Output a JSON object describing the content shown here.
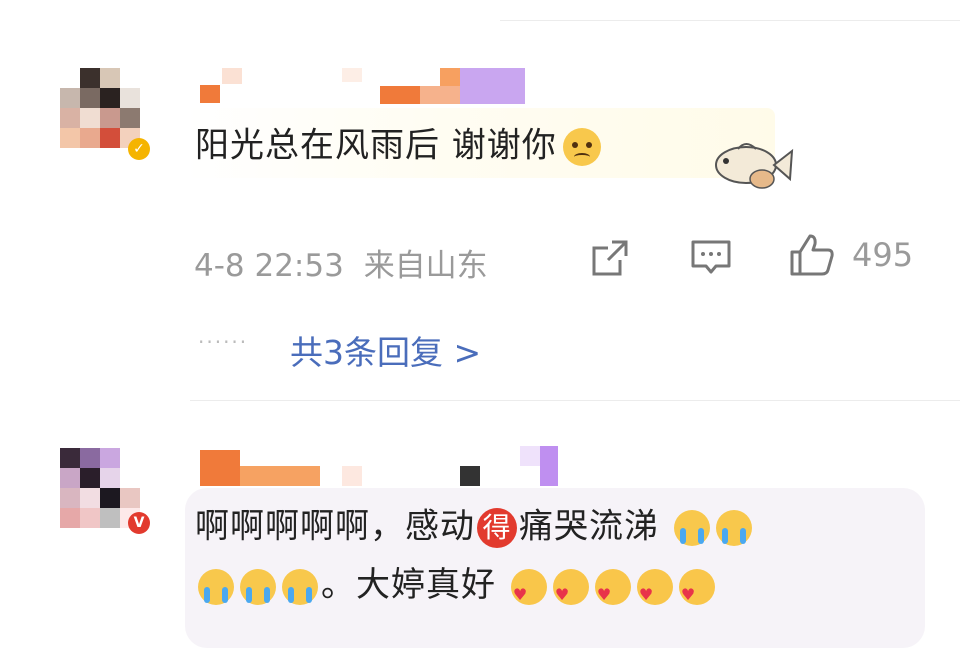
{
  "comment1": {
    "text": "阳光总在风雨后 谢谢你",
    "timestamp": "4-8 22:53",
    "location": "来自山东",
    "like_count": "495",
    "replies_label": "共3条回复 >",
    "dots": "······",
    "icons": [
      "share-icon",
      "comment-icon",
      "like-icon"
    ]
  },
  "comment2": {
    "line1_text": "啊啊啊啊啊，感动",
    "badge_char": "得",
    "line1_rest": "痛哭流涕",
    "line2_text": "。大婷真好"
  },
  "colors": {
    "link_blue": "#4a6dbb",
    "meta_gray": "#9a9a9a",
    "badge_red": "#e23a2e",
    "vip_gold": "#f5b400"
  }
}
